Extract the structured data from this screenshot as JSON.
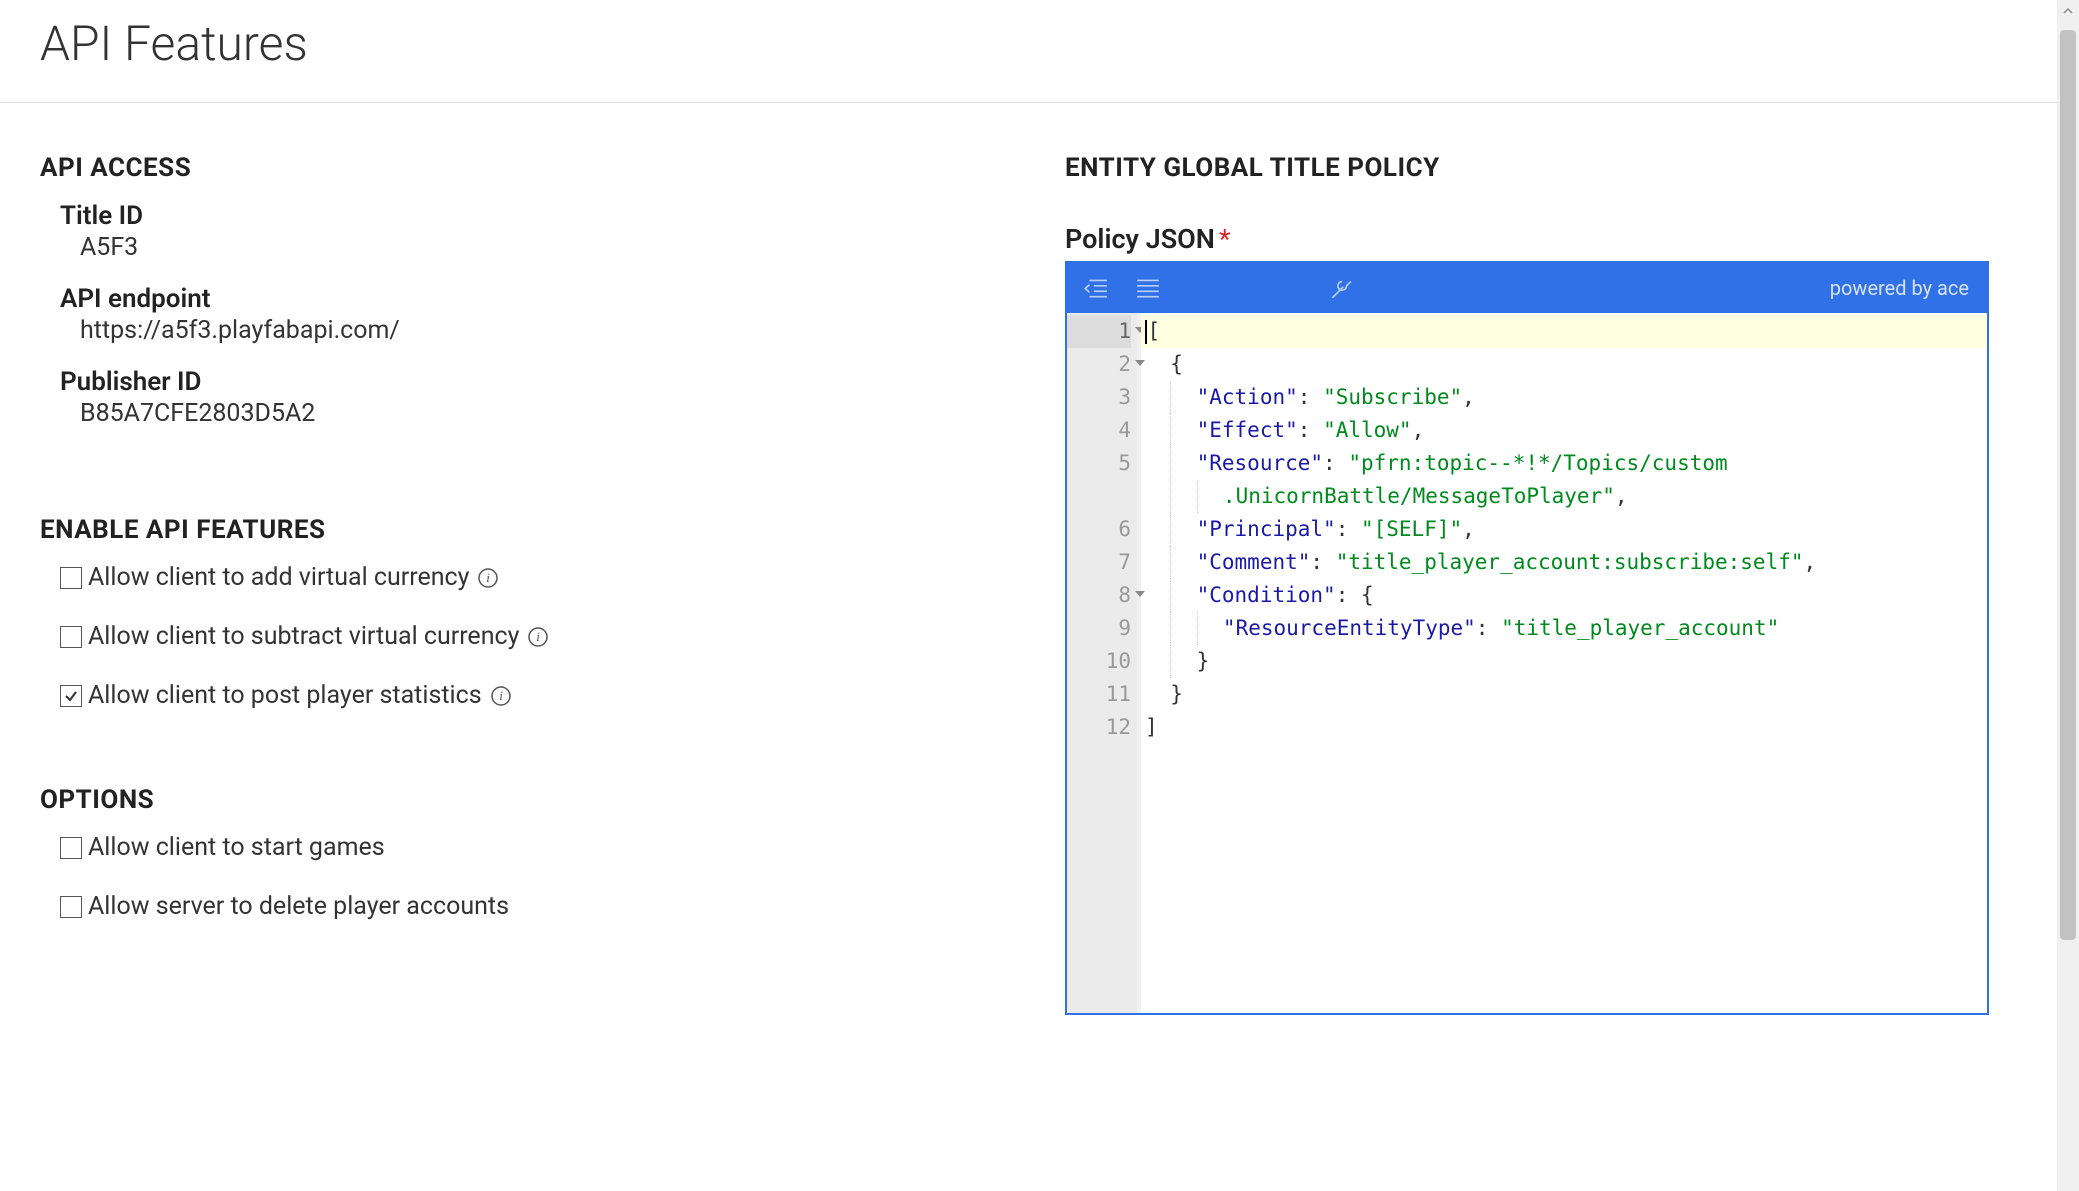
{
  "pageTitle": "API Features",
  "apiAccess": {
    "title": "API ACCESS",
    "titleIdLabel": "Title ID",
    "titleIdValue": "A5F3",
    "endpointLabel": "API endpoint",
    "endpointValue": "https://a5f3.playfabapi.com/",
    "publisherLabel": "Publisher ID",
    "publisherValue": "B85A7CFE2803D5A2"
  },
  "enableFeatures": {
    "title": "ENABLE API FEATURES",
    "items": [
      {
        "label": "Allow client to add virtual currency",
        "checked": false,
        "info": true
      },
      {
        "label": "Allow client to subtract virtual currency",
        "checked": false,
        "info": true
      },
      {
        "label": "Allow client to post player statistics",
        "checked": true,
        "info": true
      }
    ]
  },
  "options": {
    "title": "OPTIONS",
    "items": [
      {
        "label": "Allow client to start games",
        "checked": false,
        "info": false
      },
      {
        "label": "Allow server to delete player accounts",
        "checked": false,
        "info": false
      }
    ]
  },
  "policy": {
    "title": "ENTITY GLOBAL TITLE POLICY",
    "label": "Policy JSON",
    "required": "*",
    "poweredBy": "powered by ace",
    "lines": [
      {
        "n": "1",
        "fold": true,
        "current": true,
        "tokens": [
          [
            "bracket",
            "["
          ]
        ]
      },
      {
        "n": "2",
        "fold": true,
        "indent": 2,
        "tokens": [
          [
            "bracket",
            "{"
          ]
        ]
      },
      {
        "n": "3",
        "indent": 4,
        "tokens": [
          [
            "key",
            "\"Action\""
          ],
          [
            "punct",
            ": "
          ],
          [
            "string",
            "\"Subscribe\""
          ],
          [
            "punct",
            ","
          ]
        ]
      },
      {
        "n": "4",
        "indent": 4,
        "tokens": [
          [
            "key",
            "\"Effect\""
          ],
          [
            "punct",
            ": "
          ],
          [
            "string",
            "\"Allow\""
          ],
          [
            "punct",
            ","
          ]
        ]
      },
      {
        "n": "5",
        "indent": 4,
        "tokens": [
          [
            "key",
            "\"Resource\""
          ],
          [
            "punct",
            ": "
          ],
          [
            "string",
            "\"pfrn:topic--*!*/Topics/custom"
          ]
        ]
      },
      {
        "n": "",
        "indent": 6,
        "tokens": [
          [
            "string",
            ".UnicornBattle/MessageToPlayer\""
          ],
          [
            "punct",
            ","
          ]
        ]
      },
      {
        "n": "6",
        "indent": 4,
        "tokens": [
          [
            "key",
            "\"Principal\""
          ],
          [
            "punct",
            ": "
          ],
          [
            "string",
            "\"[SELF]\""
          ],
          [
            "punct",
            ","
          ]
        ]
      },
      {
        "n": "7",
        "indent": 4,
        "tokens": [
          [
            "key",
            "\"Comment\""
          ],
          [
            "punct",
            ": "
          ],
          [
            "string",
            "\"title_player_account:subscribe:self\""
          ],
          [
            "punct",
            ","
          ]
        ]
      },
      {
        "n": "8",
        "fold": true,
        "indent": 4,
        "tokens": [
          [
            "key",
            "\"Condition\""
          ],
          [
            "punct",
            ": "
          ],
          [
            "bracket",
            "{"
          ]
        ]
      },
      {
        "n": "9",
        "indent": 6,
        "tokens": [
          [
            "key",
            "\"ResourceEntityType\""
          ],
          [
            "punct",
            ": "
          ],
          [
            "string",
            "\"title_player_account\""
          ]
        ]
      },
      {
        "n": "10",
        "indent": 4,
        "tokens": [
          [
            "bracket",
            "}"
          ]
        ]
      },
      {
        "n": "11",
        "indent": 2,
        "tokens": [
          [
            "bracket",
            "}"
          ]
        ]
      },
      {
        "n": "12",
        "indent": 0,
        "tokens": [
          [
            "bracket",
            "]"
          ]
        ]
      }
    ]
  }
}
